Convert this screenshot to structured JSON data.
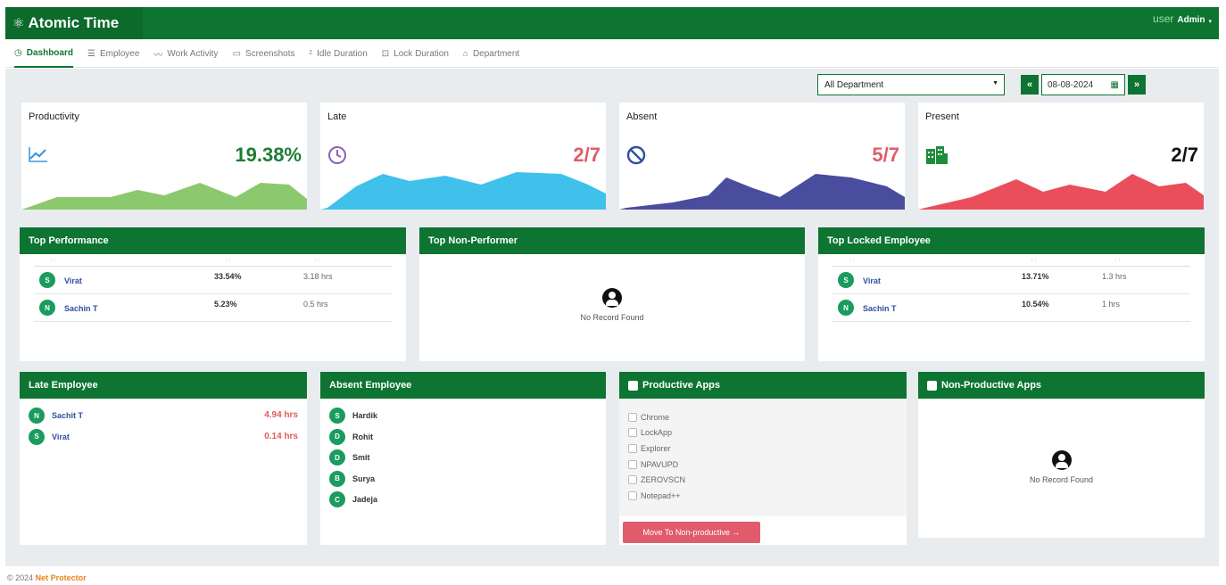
{
  "app": {
    "title": "Atomic Time",
    "user_role": "user",
    "user_name": "Admin"
  },
  "colors": {
    "brand": "#0d7431",
    "productivity": "#8cc96e",
    "late": "#3fc1eb",
    "absent": "#4a4c9e",
    "present": "#ea4e5a"
  },
  "nav": {
    "tabs": [
      {
        "label": "Dashboard",
        "icon": "gauge-icon"
      },
      {
        "label": "Employee",
        "icon": "list-icon"
      },
      {
        "label": "Work Activity",
        "icon": "pulse-icon"
      },
      {
        "label": "Screenshots",
        "icon": "monitor-icon"
      },
      {
        "label": "Idle Duration",
        "icon": "sleep-icon"
      },
      {
        "label": "Lock Duration",
        "icon": "lock-icon"
      },
      {
        "label": "Department",
        "icon": "building-icon"
      }
    ]
  },
  "filters": {
    "department": "All Department",
    "date": "08-08-2024",
    "prev": "«",
    "next": "»"
  },
  "stats": {
    "productivity": {
      "title": "Productivity",
      "value": "19.38%",
      "icon": "trend-up-icon"
    },
    "late": {
      "title": "Late",
      "value": "2/7",
      "icon": "clock-icon"
    },
    "absent": {
      "title": "Absent",
      "value": "5/7",
      "icon": "ban-icon"
    },
    "present": {
      "title": "Present",
      "value": "2/7",
      "icon": "building-icon"
    }
  },
  "top_performance": {
    "title": "Top Performance",
    "rows": [
      {
        "initial": "S",
        "name": "Virat",
        "pct": "33.54%",
        "hrs": "3.18 hrs"
      },
      {
        "initial": "N",
        "name": "Sachin T",
        "pct": "5.23%",
        "hrs": "0.5 hrs"
      }
    ]
  },
  "top_non_performer": {
    "title": "Top Non-Performer",
    "empty": "No Record Found"
  },
  "top_locked": {
    "title": "Top Locked Employee",
    "rows": [
      {
        "initial": "S",
        "name": "Virat",
        "pct": "13.71%",
        "hrs": "1.3 hrs"
      },
      {
        "initial": "N",
        "name": "Sachin T",
        "pct": "10.54%",
        "hrs": "1 hrs"
      }
    ]
  },
  "late_employee": {
    "title": "Late Employee",
    "rows": [
      {
        "initial": "N",
        "name": "Sachit T",
        "hrs": "4.94 hrs"
      },
      {
        "initial": "S",
        "name": "Virat",
        "hrs": "0.14 hrs"
      }
    ]
  },
  "absent_employee": {
    "title": "Absent Employee",
    "rows": [
      {
        "initial": "S",
        "name": "Hardik"
      },
      {
        "initial": "D",
        "name": "Rohit"
      },
      {
        "initial": "D",
        "name": "Smit"
      },
      {
        "initial": "B",
        "name": "Surya"
      },
      {
        "initial": "C",
        "name": "Jadeja"
      }
    ]
  },
  "productive_apps": {
    "title": "Productive Apps",
    "apps": [
      "Chrome",
      "LockApp",
      "Explorer",
      "NPAVUPD",
      "ZEROVSCN",
      "Notepad++"
    ],
    "button": "Move To Non-productive →"
  },
  "non_productive_apps": {
    "title": "Non-Productive Apps",
    "empty": "No Record Found"
  },
  "footer": {
    "copyright": "© 2024",
    "company": "Net Protector"
  }
}
